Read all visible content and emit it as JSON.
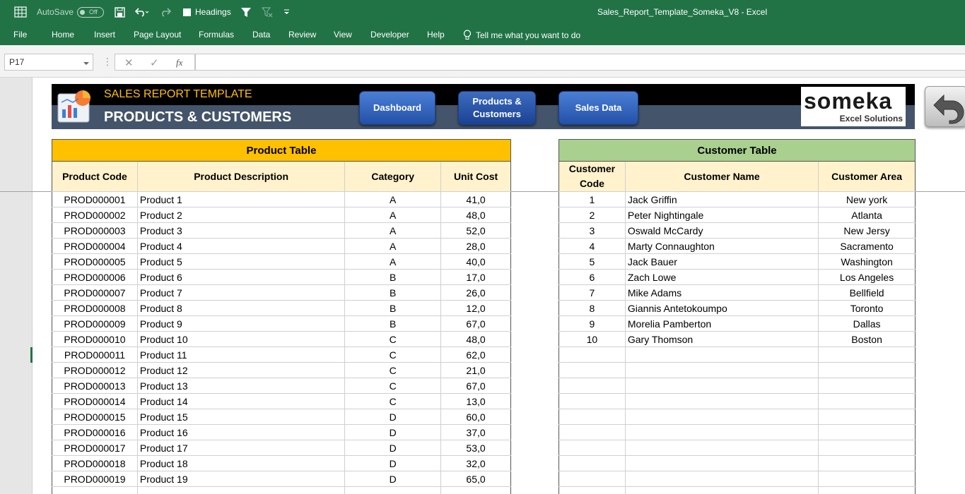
{
  "titlebar": {
    "autosave_label": "AutoSave",
    "autosave_state": "Off",
    "headings_label": "Headings",
    "title": "Sales_Report_Template_Someka_V8  -  Excel"
  },
  "ribbon": {
    "tabs": [
      "File",
      "Home",
      "Insert",
      "Page Layout",
      "Formulas",
      "Data",
      "Review",
      "View",
      "Developer",
      "Help"
    ],
    "tell_me": "Tell me what you want to do"
  },
  "formula_bar": {
    "name_box": "P17",
    "fx": "fx",
    "formula": ""
  },
  "banner": {
    "title": "SALES REPORT TEMPLATE",
    "subtitle": "PRODUCTS & CUSTOMERS",
    "buttons": {
      "dashboard": "Dashboard",
      "products_line1": "Products &",
      "products_line2": "Customers",
      "sales_data": "Sales Data"
    },
    "logo_main": "someka",
    "logo_sub": "Excel Solutions"
  },
  "product_table": {
    "title": "Product Table",
    "headers": [
      "Product Code",
      "Product Description",
      "Category",
      "Unit Cost"
    ],
    "rows": [
      [
        "PROD000001",
        "Product 1",
        "A",
        "41,0"
      ],
      [
        "PROD000002",
        "Product 2",
        "A",
        "48,0"
      ],
      [
        "PROD000003",
        "Product 3",
        "A",
        "52,0"
      ],
      [
        "PROD000004",
        "Product 4",
        "A",
        "28,0"
      ],
      [
        "PROD000005",
        "Product 5",
        "A",
        "40,0"
      ],
      [
        "PROD000006",
        "Product 6",
        "B",
        "17,0"
      ],
      [
        "PROD000007",
        "Product 7",
        "B",
        "26,0"
      ],
      [
        "PROD000008",
        "Product 8",
        "B",
        "12,0"
      ],
      [
        "PROD000009",
        "Product 9",
        "B",
        "67,0"
      ],
      [
        "PROD000010",
        "Product 10",
        "C",
        "48,0"
      ],
      [
        "PROD000011",
        "Product 11",
        "C",
        "62,0"
      ],
      [
        "PROD000012",
        "Product 12",
        "C",
        "21,0"
      ],
      [
        "PROD000013",
        "Product 13",
        "C",
        "67,0"
      ],
      [
        "PROD000014",
        "Product 14",
        "C",
        "13,0"
      ],
      [
        "PROD000015",
        "Product 15",
        "D",
        "60,0"
      ],
      [
        "PROD000016",
        "Product 16",
        "D",
        "37,0"
      ],
      [
        "PROD000017",
        "Product 17",
        "D",
        "53,0"
      ],
      [
        "PROD000018",
        "Product 18",
        "D",
        "32,0"
      ],
      [
        "PROD000019",
        "Product 19",
        "D",
        "65,0"
      ]
    ]
  },
  "customer_table": {
    "title": "Customer Table",
    "headers": [
      "Customer Code",
      "Customer Name",
      "Customer Area"
    ],
    "rows": [
      [
        "1",
        "Jack Griffin",
        "New york"
      ],
      [
        "2",
        "Peter Nightingale",
        "Atlanta"
      ],
      [
        "3",
        "Oswald McCardy",
        "New Jersy"
      ],
      [
        "4",
        "Marty Connaughton",
        "Sacramento"
      ],
      [
        "5",
        "Jack Bauer",
        "Washington"
      ],
      [
        "6",
        "Zach Lowe",
        "Los Angeles"
      ],
      [
        "7",
        "Mike Adams",
        "Bellfield"
      ],
      [
        "8",
        "Giannis Antetokoumpo",
        "Toronto"
      ],
      [
        "9",
        "Morelia Pamberton",
        "Dallas"
      ],
      [
        "10",
        "Gary Thomson",
        "Boston"
      ]
    ]
  },
  "colors": {
    "excel_green": "#217346",
    "product_header": "#ffc000",
    "customer_header": "#a9d08e",
    "subheader": "#fff2cc",
    "banner_dark": "#000000",
    "banner_slate": "#44546a",
    "banner_title": "#ffc000"
  }
}
